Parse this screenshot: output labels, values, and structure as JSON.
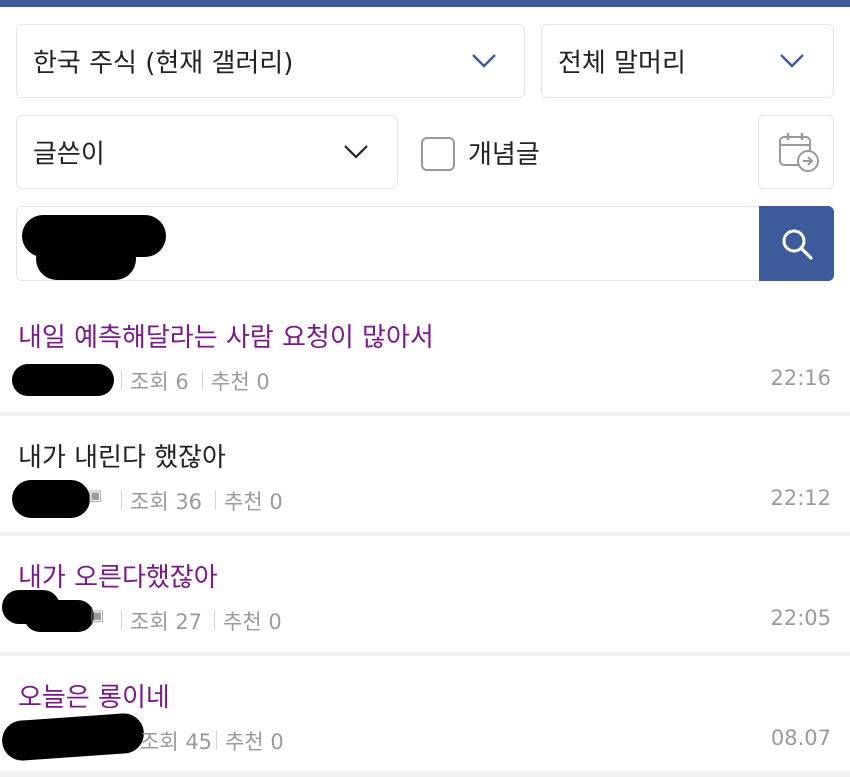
{
  "filters": {
    "gallery_select": "한국 주식 (현재 갤러리)",
    "head_select": "전체 말머리",
    "search_type_select": "글쓴이",
    "concept_checkbox_label": "개념글",
    "concept_checked": false
  },
  "search": {
    "query": "",
    "placeholder": ""
  },
  "icons": {
    "chevron": "chevron-down-icon",
    "calendar": "calendar-arrow-icon",
    "search": "search-icon"
  },
  "colors": {
    "brand": "#3d5a9a",
    "visited_title": "#7a1a8a",
    "meta": "#9a9a9a"
  },
  "posts": [
    {
      "title": "내일 예측해달라는 사람 요청이 많아서",
      "views": "조회 6",
      "recommends": "추천 0",
      "time": "22:16",
      "visited": true
    },
    {
      "title": "내가 내린다 했잖아",
      "views": "조회 36",
      "recommends": "추천 0",
      "time": "22:12",
      "visited": false
    },
    {
      "title": "내가 오른다했잖아",
      "views": "조회 27",
      "recommends": "추천 0",
      "time": "22:05",
      "visited": true
    },
    {
      "title": "오늘은 롱이네",
      "views": "조회 45",
      "recommends": "추천 0",
      "time": "08.07",
      "visited": true
    }
  ]
}
